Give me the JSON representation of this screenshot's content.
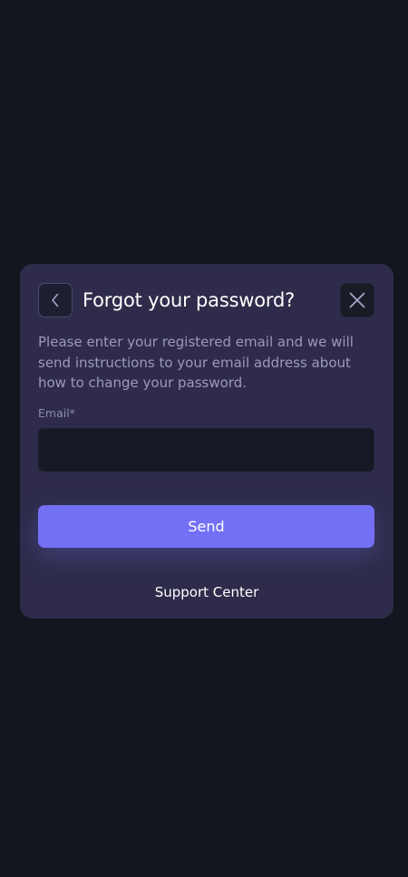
{
  "dialog": {
    "title": "Forgot your password?",
    "description": "Please enter your registered email and we will send instructions to your email address about how to change your password.",
    "email_label": "Email*",
    "email_value": "",
    "email_placeholder": "",
    "send_label": "Send",
    "support_label": "Support Center",
    "back_icon": "chevron-left-icon",
    "close_icon": "close-icon"
  },
  "colors": {
    "background": "#14161f",
    "card": "#2e2c4a",
    "accent": "#7370f6",
    "input": "#161824"
  }
}
